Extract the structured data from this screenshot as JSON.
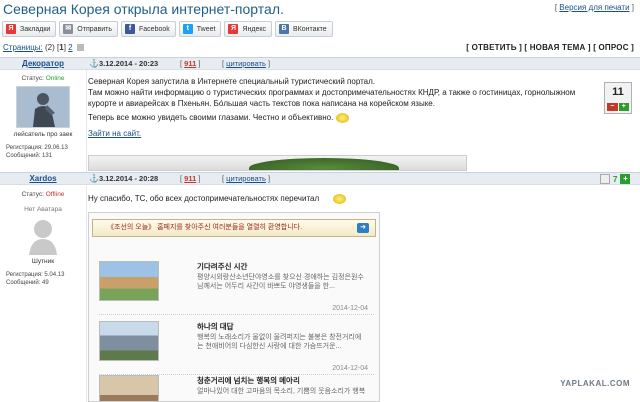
{
  "title": "Северная Корея открыла интернет-портал.",
  "print_link": {
    "prefix": "[ ",
    "label": "Версия для печати",
    "suffix": " ]"
  },
  "share": [
    {
      "label": "Закладки",
      "icon": "yandex-bookmark-icon",
      "color": "#e53935",
      "glyph": "Я"
    },
    {
      "label": "Отправить",
      "icon": "mail-icon",
      "color": "#8a8f99",
      "glyph": "✉"
    },
    {
      "label": "Facebook",
      "icon": "facebook-icon",
      "color": "#3b5998",
      "glyph": "f"
    },
    {
      "label": "Tweet",
      "icon": "twitter-icon",
      "color": "#1da1f2",
      "glyph": "t"
    },
    {
      "label": "Яндекс",
      "icon": "yandex-icon",
      "color": "#e53935",
      "glyph": "Я"
    },
    {
      "label": "ВКонтакте",
      "icon": "vk-icon",
      "color": "#4a76a8",
      "glyph": "В"
    }
  ],
  "pagination": {
    "label": "Страницы:",
    "count": "(2)",
    "current": "1",
    "next": "2"
  },
  "actions": {
    "reply": "[ ОТВЕТИТЬ ]",
    "new_topic": "[ НОВАЯ ТЕМА ]",
    "poll": "[ ОПРОС ]"
  },
  "posts": [
    {
      "author": "Декоратор",
      "date": "3.12.2014 - 20:23",
      "number": "911",
      "quote": "цитировать",
      "status_label": "Статус:",
      "status": "Online",
      "avatar_caption": "лейсатель про заек",
      "reg_label": "Регистрация:",
      "reg": "29.06.13",
      "msgs_label": "Сообщений:",
      "msgs": "131",
      "text1": "Северная Корея запустила в Интернете специальный туристический портал.",
      "text2": "Там можно найти информацию о туристических программах и достопримечательностях КНДР, а также о гостиницах, горнолыжном курорте и авиарейсах в Пхеньян. Бóльшая часть текстов пока написана на корейском языке.",
      "text3": "Теперь все можно увидеть своими глазами. Честно и объективно.",
      "link": "Зайти на сайт.",
      "rating": "11",
      "rating_minus": "−",
      "rating_plus": "+"
    },
    {
      "author": "Xardos",
      "date": "3.12.2014 - 20:28",
      "number": "911",
      "quote": "цитировать",
      "status_label": "Статус:",
      "status": "Offline",
      "no_avatar": "Нет Аватара",
      "avatar_caption": "Шутник",
      "reg_label": "Регистрация:",
      "reg": "5.04.13",
      "msgs_label": "Сообщений:",
      "msgs": "49",
      "text1": "Ну спасибо, ТС, обо всех достопримечательностях перечитал",
      "rating": "7",
      "rating_plus": "+"
    }
  ],
  "embed": {
    "banner": "《조선의 오늘》 홈페지를 찾아주신 여러분들을 열렬히 환영합니다.",
    "arrow": "➜",
    "news": [
      {
        "title": "기다려주신 시간",
        "text": "평양시외랑산소년단야영소를 찾으신 경애하는 김정은원수님께서는 어두리 사간이 바쁘도 야영생들을 한...",
        "date": "2014-12-04"
      },
      {
        "title": "하나의 대답",
        "text": "행복의 노래소리가 울없이 울려퍼지는 불봉은 창전거리에는 천애비어의 다심한신 사랑에 대한 가슴뜨거운...",
        "date": "2014-12-04"
      },
      {
        "title": "청춘거리에 넘치는 행복의 메아리",
        "text": "얼마나있어 대한 고마움의 목소리, 기쁨의 웃음소리가 행복",
        "date": ""
      }
    ]
  },
  "watermark": "YAPLAKAL.COM"
}
